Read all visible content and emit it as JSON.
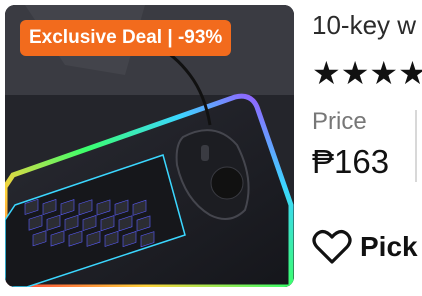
{
  "product": {
    "badge": "Exclusive Deal | -93%",
    "title": "10-key w",
    "stars": "★★★★",
    "rating_stars_visible": 4,
    "price_label": "Price",
    "price_value": "₱163",
    "pick_label": "Pick"
  },
  "colors": {
    "badge": "#f26b1d",
    "rgb_glow": [
      "#ff3b3b",
      "#ffd23b",
      "#3bff6b",
      "#3bd7ff",
      "#b03bff"
    ]
  },
  "icons": {
    "product_image": "keyboard-mouse-photo",
    "pick": "heart-outline-icon"
  }
}
